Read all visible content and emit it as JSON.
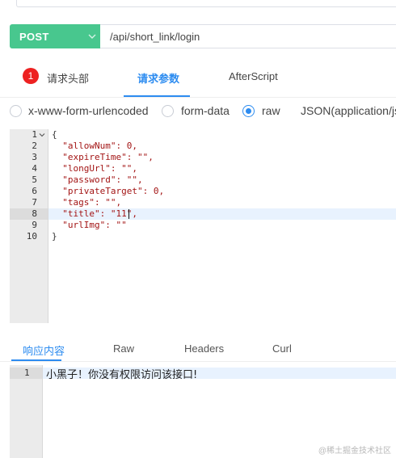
{
  "request": {
    "method": "POST",
    "url": "/api/short_link/login",
    "accent": "#48c78e"
  },
  "tabs": [
    {
      "label": "请求头部",
      "badge": "1",
      "active": false
    },
    {
      "label": "请求参数",
      "active": true
    },
    {
      "label": "AfterScript",
      "active": false
    }
  ],
  "body_types": [
    {
      "label": "x-www-form-urlencoded",
      "selected": false
    },
    {
      "label": "form-data",
      "selected": false
    },
    {
      "label": "raw",
      "selected": true
    },
    {
      "label": "JSON(application/js",
      "selected": false
    }
  ],
  "editor": {
    "line_numbers": [
      "1",
      "2",
      "3",
      "4",
      "5",
      "6",
      "7",
      "8",
      "9",
      "10"
    ],
    "lines": [
      "{",
      "  \"allowNum\": 0,",
      "  \"expireTime\": \"\",",
      "  \"longUrl\": \"\",",
      "  \"password\": \"\",",
      "  \"privateTarget\": 0,",
      "  \"tags\": \"\",",
      "  \"title\": \"11\",",
      "  \"urlImg\": \"\"",
      "}"
    ],
    "active_line": 8
  },
  "response_tabs": [
    {
      "label": "响应内容",
      "active": true
    },
    {
      "label": "Raw",
      "active": false
    },
    {
      "label": "Headers",
      "active": false
    },
    {
      "label": "Curl",
      "active": false
    }
  ],
  "response": {
    "line_number": "1",
    "text": "小黑子！你没有权限访问该接口!"
  },
  "watermark": "@稀土掘金技术社区",
  "colors": {
    "link": "#2d8cf0",
    "badge": "#ed2121"
  }
}
